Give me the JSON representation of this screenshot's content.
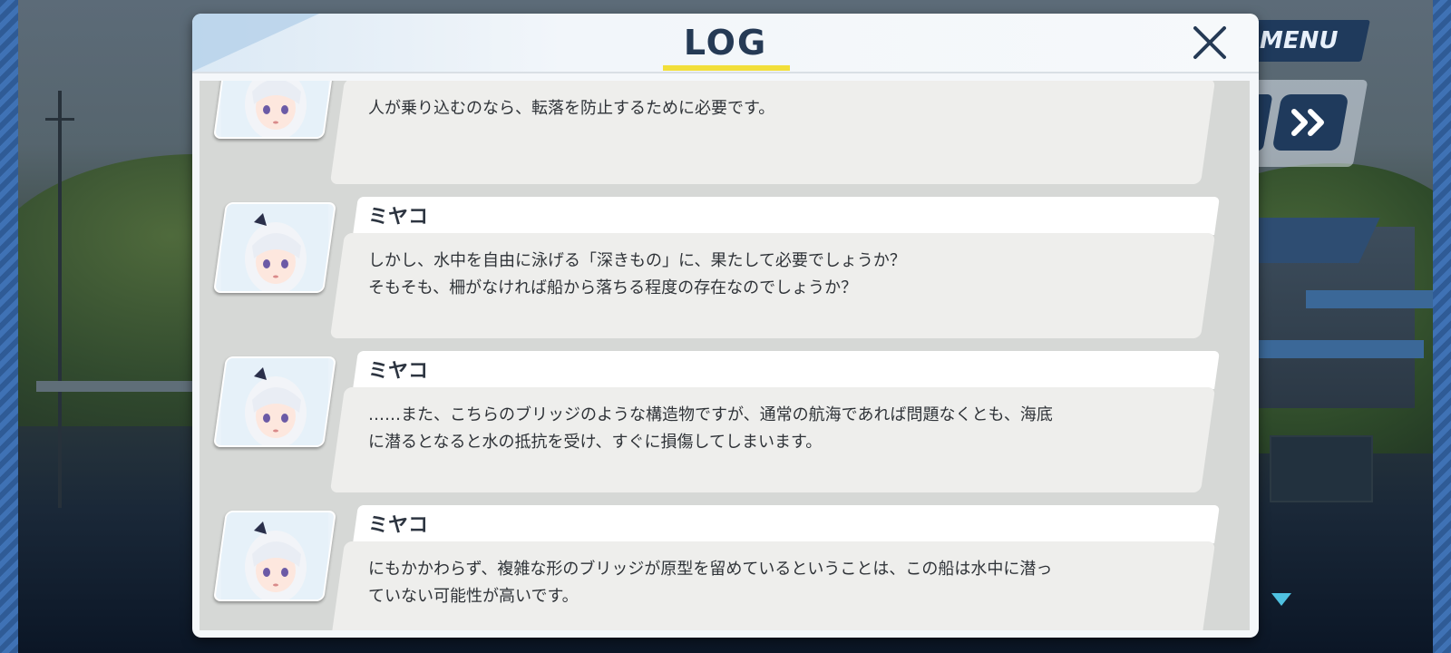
{
  "hud": {
    "menu_label": "MENU",
    "fast_forward_icon": "fast-forward-icon",
    "scroll_down_icon": "triangle-down-icon"
  },
  "dialog": {
    "title": "LOG",
    "close_icon": "close-x-icon",
    "accent_color": "#f2df3a",
    "entries": [
      {
        "speaker": "",
        "portrait": "miyako-portrait",
        "lines": [
          "人が乗り込むのなら、転落を防止するために必要です。"
        ]
      },
      {
        "speaker": "ミヤコ",
        "portrait": "miyako-portrait",
        "lines": [
          "しかし、水中を自由に泳げる「深きもの」に、果たして必要でしょうか？",
          "そもそも、柵がなければ船から落ちる程度の存在なのでしょうか？"
        ]
      },
      {
        "speaker": "ミヤコ",
        "portrait": "miyako-portrait",
        "lines": [
          "……また、こちらのブリッジのような構造物ですが、通常の航海であれば問題なくとも、海底",
          "に潜るとなると水の抵抗を受け、すぐに損傷してしまいます。"
        ]
      },
      {
        "speaker": "ミヤコ",
        "portrait": "miyako-portrait",
        "lines": [
          "にもかかわらず、複雑な形のブリッジが原型を留めているということは、この船は水中に潜っ",
          "ていない可能性が高いです。"
        ]
      }
    ]
  }
}
